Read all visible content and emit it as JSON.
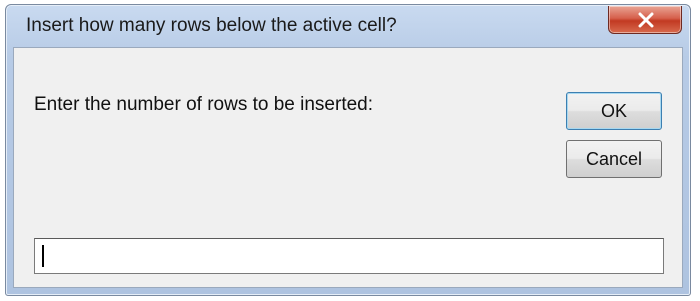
{
  "dialog": {
    "title": "Insert how many rows below the active cell?",
    "prompt": "Enter the number of rows to be inserted:",
    "ok_label": "OK",
    "cancel_label": "Cancel",
    "close_icon": "close-icon",
    "input": {
      "value": "",
      "placeholder": ""
    }
  },
  "colors": {
    "frame": "#b7cbe6",
    "close_button": "#c23a22",
    "client_background": "#f0f0f0",
    "ok_focus_border": "#3c7fb1"
  }
}
